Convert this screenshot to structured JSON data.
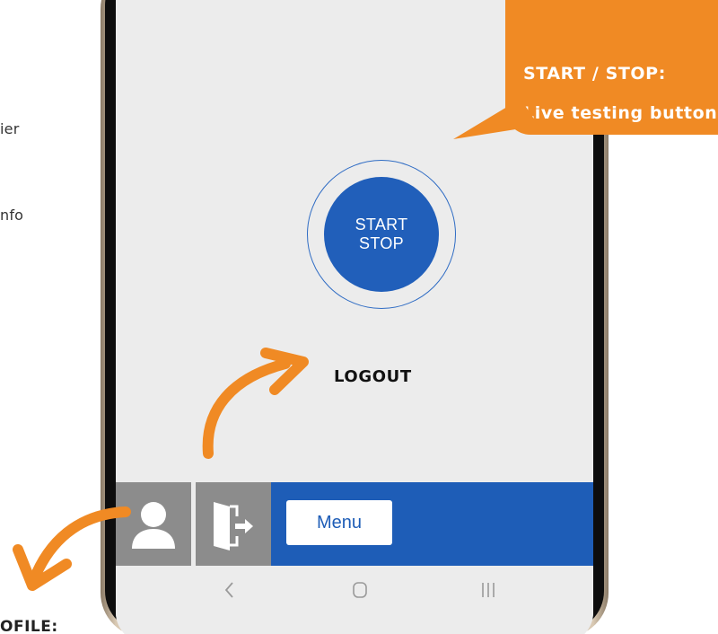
{
  "left_text": {
    "line1": "ier",
    "line2": "nfo",
    "bottom": "OFILE:"
  },
  "start_button": {
    "line1": "START",
    "line2": "STOP"
  },
  "callout": {
    "title": "START / STOP:",
    "subtitle": "Live testing button"
  },
  "logout_label": "LOGOUT",
  "bottom_bar": {
    "menu_label": "Menu",
    "profile_icon": "user-icon",
    "logout_icon": "exit-door-icon"
  },
  "nav_keys": {
    "back_icon": "back-chevron-icon",
    "home_icon": "home-icon",
    "recents_icon": "recents-icon"
  },
  "colors": {
    "accent_blue": "#1e5db7",
    "callout_orange": "#f08a24",
    "screen_bg": "#ececec",
    "icon_box_gray": "#8c8c8c"
  }
}
